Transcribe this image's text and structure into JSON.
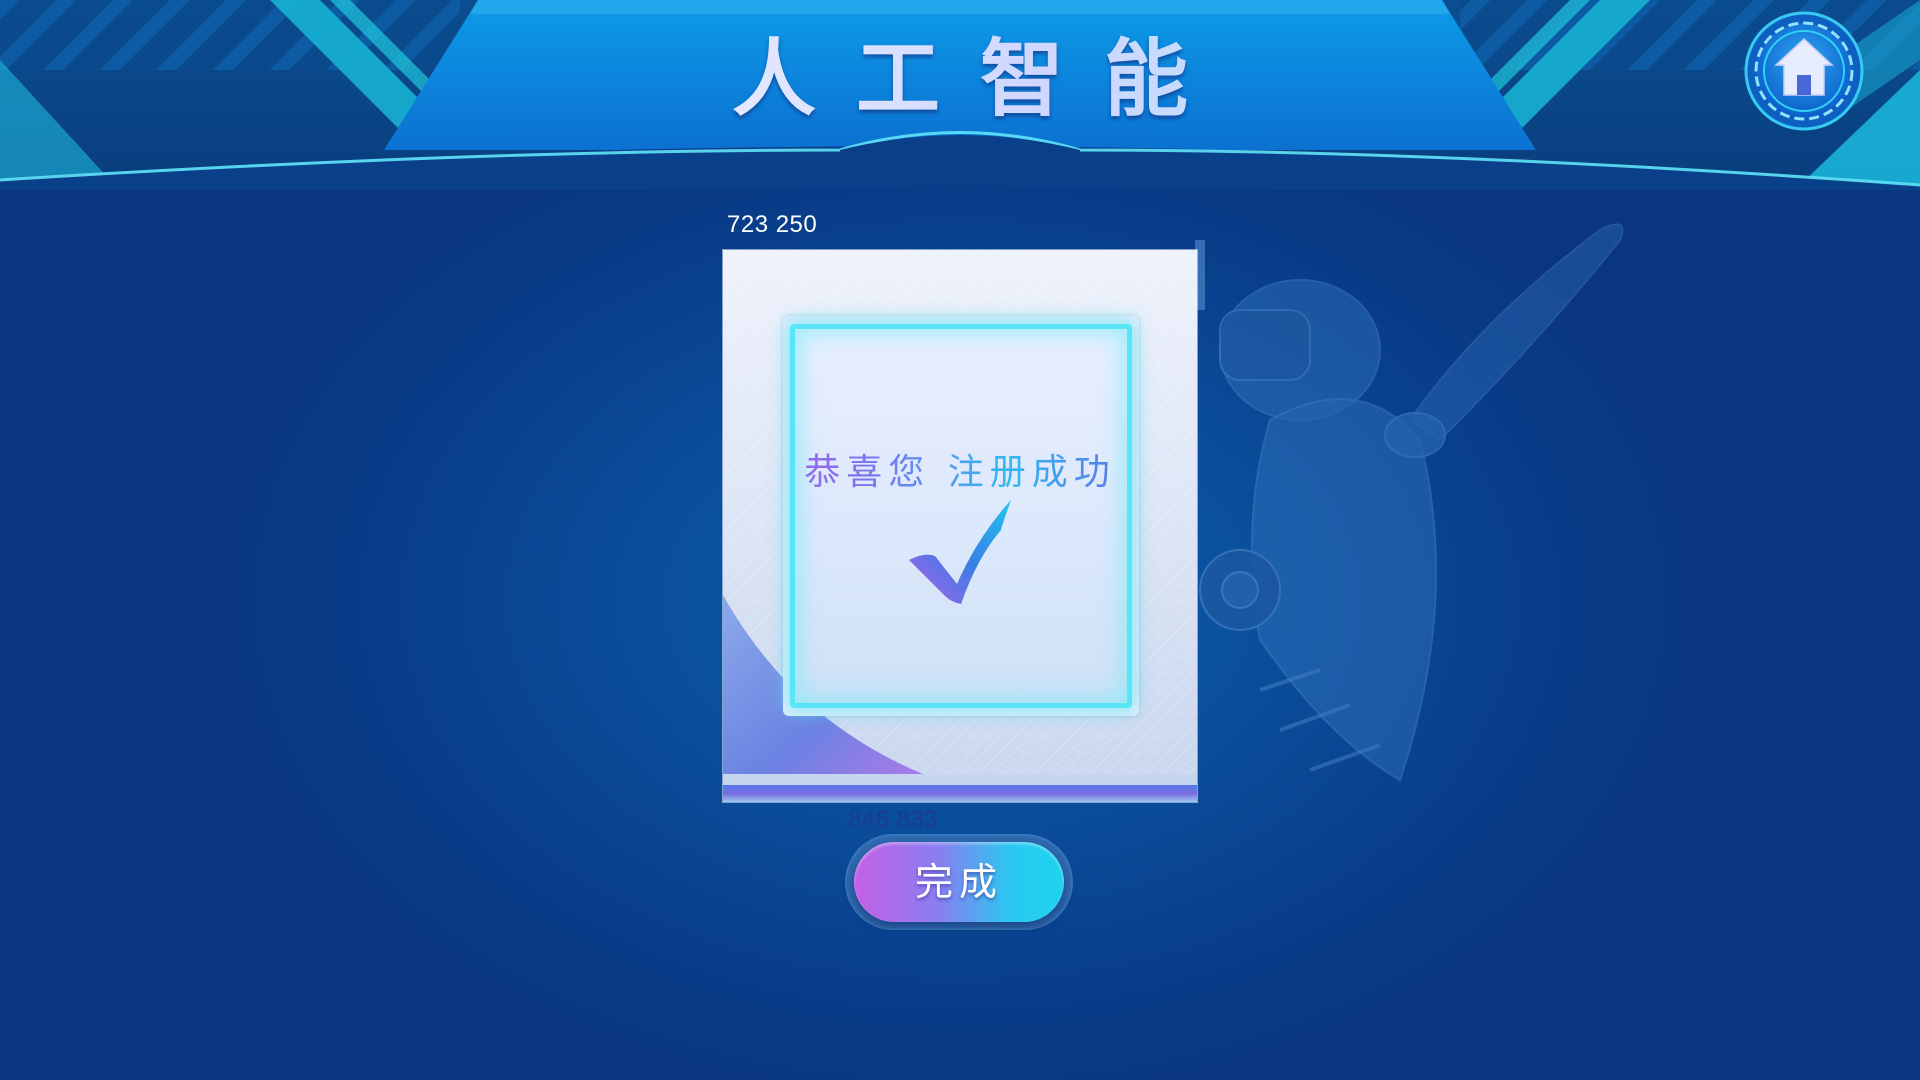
{
  "header": {
    "title": "人工智能"
  },
  "home": {
    "icon": "home-icon"
  },
  "debug_text": {
    "top_coords": "723  250",
    "bottom_coords": "846  833"
  },
  "dialog": {
    "message": "恭喜您 注册成功",
    "icon": "check-icon"
  },
  "actions": {
    "done_label": "完成"
  },
  "colors": {
    "background": "#0a4f9c",
    "header": "#0a6fd3",
    "accent_cyan": "#58e6f6",
    "accent_purple": "#b05de8"
  }
}
